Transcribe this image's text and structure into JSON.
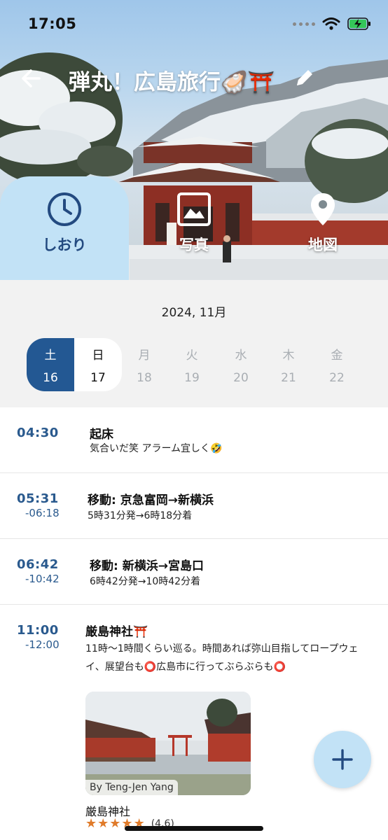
{
  "status_bar": {
    "time": "17:05"
  },
  "header": {
    "title": "弾丸！広島旅行🦪⛩️"
  },
  "tabs": [
    {
      "label": "しおり",
      "icon": "clock-icon",
      "active": true
    },
    {
      "label": "写真",
      "icon": "image-icon",
      "active": false
    },
    {
      "label": "地図",
      "icon": "map-pin-icon",
      "active": false
    }
  ],
  "calendar": {
    "month": "2024, 11月",
    "days": [
      {
        "dow": "土",
        "num": "16",
        "state": "selected"
      },
      {
        "dow": "日",
        "num": "17",
        "state": "current"
      },
      {
        "dow": "月",
        "num": "18",
        "state": "muted"
      },
      {
        "dow": "火",
        "num": "19",
        "state": "muted"
      },
      {
        "dow": "水",
        "num": "20",
        "state": "muted"
      },
      {
        "dow": "木",
        "num": "21",
        "state": "muted"
      },
      {
        "dow": "金",
        "num": "22",
        "state": "muted"
      }
    ]
  },
  "schedule": [
    {
      "start": "04:30",
      "end": "",
      "title": "起床",
      "desc": "気合いだ笑 アラーム宜しく🤣"
    },
    {
      "start": "05:31",
      "end": "-06:18",
      "title": "移動: 京急富岡→新横浜",
      "desc": "5時31分発→6時18分着"
    },
    {
      "start": "06:42",
      "end": "-10:42",
      "title": "移動: 新横浜→宮島口",
      "desc": "6時42分発→10時42分着"
    },
    {
      "start": "11:00",
      "end": "-12:00",
      "title": "厳島神社⛩️",
      "desc": "11時〜1時間くらい巡る。時間あれば弥山目指してロープウェイ、展望台も⭕️広島市に行ってぶらぶらも⭕️",
      "place": {
        "photo_credit": "By Teng-Jen Yang",
        "name": "厳島神社",
        "rating": 4.6,
        "rating_text": "(4.6)"
      }
    }
  ],
  "colors": {
    "accent": "#235893",
    "tab_active_bg": "#c2e2f6",
    "star": "#e07b2a"
  }
}
